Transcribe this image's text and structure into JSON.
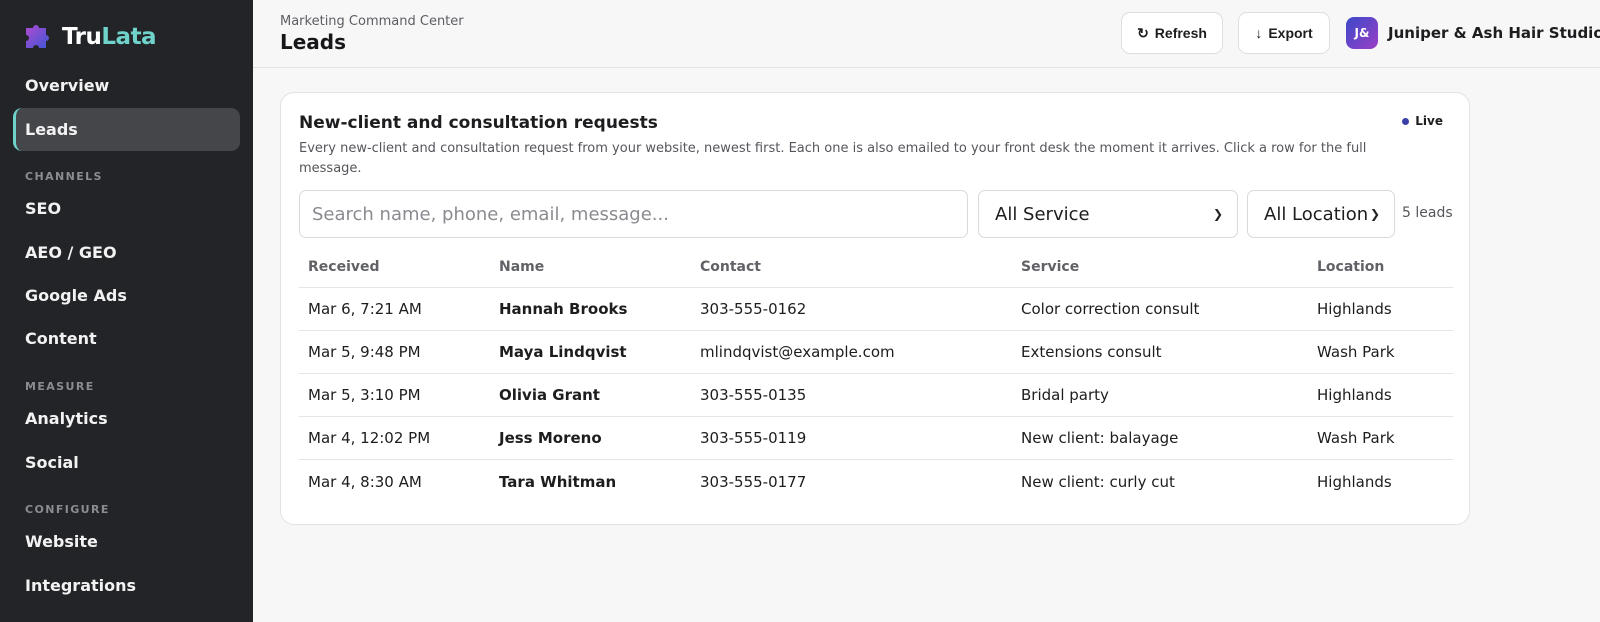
{
  "brand": {
    "name_part1": "Tru",
    "name_part2": "Lata",
    "accent": "#6fd3cb"
  },
  "sidebar": {
    "items": [
      {
        "label": "Overview"
      },
      {
        "label": "Leads",
        "active": true
      },
      {
        "label": "SEO"
      },
      {
        "label": "AEO / GEO"
      },
      {
        "label": "Google Ads"
      },
      {
        "label": "Content"
      },
      {
        "label": "Analytics"
      },
      {
        "label": "Social"
      },
      {
        "label": "Website"
      },
      {
        "label": "Integrations"
      }
    ],
    "sections": [
      "CHANNELS",
      "MEASURE",
      "CONFIGURE"
    ]
  },
  "header": {
    "breadcrumb": "Marketing Command Center",
    "title": "Leads",
    "refresh_label": "Refresh",
    "refresh_icon": "refresh-icon",
    "export_label": "Export",
    "export_icon": "arrow-down-icon",
    "avatar_initials": "J&",
    "studio_name": "Juniper & Ash Hair Studio"
  },
  "card": {
    "title": "New-client and consultation requests",
    "live_label": "Live",
    "description": "Every new-client and consultation request from your website, newest first. Each one is also emailed to your front desk the moment it arrives. Click a row for the full message.",
    "search_placeholder": "Search name, phone, email, message...",
    "service_filter": "All Service",
    "location_filter": "All Location",
    "lead_count": "5 leads"
  },
  "table": {
    "columns": [
      "Received",
      "Name",
      "Contact",
      "Service",
      "Location"
    ],
    "rows": [
      [
        "Mar 6, 7:21 AM",
        "Hannah Brooks",
        "303-555-0162",
        "Color correction consult",
        "Highlands"
      ],
      [
        "Mar 5, 9:48 PM",
        "Maya Lindqvist",
        "mlindqvist@example.com",
        "Extensions consult",
        "Wash Park"
      ],
      [
        "Mar 5, 3:10 PM",
        "Olivia Grant",
        "303-555-0135",
        "Bridal party",
        "Highlands"
      ],
      [
        "Mar 4, 12:02 PM",
        "Jess Moreno",
        "303-555-0119",
        "New client: balayage",
        "Wash Park"
      ],
      [
        "Mar 4, 8:30 AM",
        "Tara Whitman",
        "303-555-0177",
        "New client: curly cut",
        "Highlands"
      ]
    ]
  }
}
